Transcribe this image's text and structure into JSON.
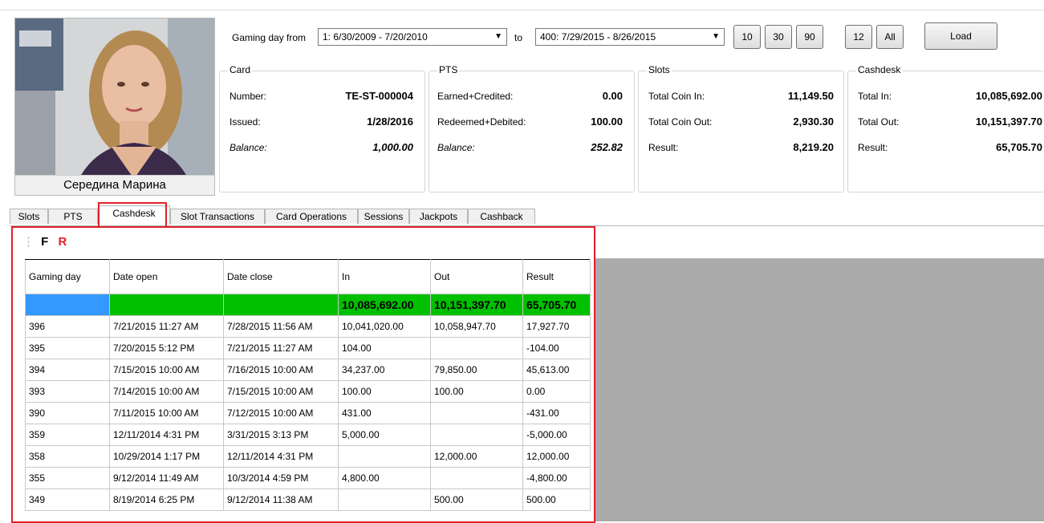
{
  "profile": {
    "name": "Середина Марина"
  },
  "filter": {
    "from_label": "Gaming day from",
    "from_value": "1: 6/30/2009 - 7/20/2010",
    "to_label": "to",
    "to_value": "400: 7/29/2015 - 8/26/2015",
    "quick_buttons": [
      "10",
      "30",
      "90",
      "12",
      "All"
    ],
    "load_label": "Load"
  },
  "groups": {
    "card": {
      "title": "Card",
      "number_label": "Number:",
      "number_value": "TE-ST-000004",
      "issued_label": "Issued:",
      "issued_value": "1/28/2016",
      "balance_label": "Balance:",
      "balance_value": "1,000.00"
    },
    "pts": {
      "title": "PTS",
      "earned_label": "Earned+Credited:",
      "earned_value": "0.00",
      "redeemed_label": "Redeemed+Debited:",
      "redeemed_value": "100.00",
      "balance_label": "Balance:",
      "balance_value": "252.82"
    },
    "slots": {
      "title": "Slots",
      "coin_in_label": "Total Coin In:",
      "coin_in_value": "11,149.50",
      "coin_out_label": "Total Coin Out:",
      "coin_out_value": "2,930.30",
      "result_label": "Result:",
      "result_value": "8,219.20"
    },
    "cashdesk": {
      "title": "Cashdesk",
      "in_label": "Total In:",
      "in_value": "10,085,692.00",
      "out_label": "Total Out:",
      "out_value": "10,151,397.70",
      "result_label": "Result:",
      "result_value": "65,705.70"
    }
  },
  "tabs": [
    "Slots",
    "PTS",
    "Cashdesk",
    "Slot Transactions",
    "Card Operations",
    "Sessions",
    "Jackpots",
    "Cashback"
  ],
  "active_tab": "Cashdesk",
  "toolbar": {
    "f_label": "F",
    "r_label": "R"
  },
  "grid": {
    "columns": [
      "Gaming day",
      "Date open",
      "Date close",
      "In",
      "Out",
      "Result"
    ],
    "totals": {
      "in": "10,085,692.00",
      "out": "10,151,397.70",
      "result": "65,705.70"
    },
    "rows": [
      [
        "396",
        "7/21/2015 11:27 AM",
        "7/28/2015 11:56 AM",
        "10,041,020.00",
        "10,058,947.70",
        "17,927.70"
      ],
      [
        "395",
        "7/20/2015 5:12 PM",
        "7/21/2015 11:27 AM",
        "104.00",
        "",
        "-104.00"
      ],
      [
        "394",
        "7/15/2015 10:00 AM",
        "7/16/2015 10:00 AM",
        "34,237.00",
        "79,850.00",
        "45,613.00"
      ],
      [
        "393",
        "7/14/2015 10:00 AM",
        "7/15/2015 10:00 AM",
        "100.00",
        "100.00",
        "0.00"
      ],
      [
        "390",
        "7/11/2015 10:00 AM",
        "7/12/2015 10:00 AM",
        "431.00",
        "",
        "-431.00"
      ],
      [
        "359",
        "12/11/2014 4:31 PM",
        "3/31/2015 3:13 PM",
        "5,000.00",
        "",
        "-5,000.00"
      ],
      [
        "358",
        "10/29/2014 1:17 PM",
        "12/11/2014 4:31 PM",
        "",
        "12,000.00",
        "12,000.00"
      ],
      [
        "355",
        "9/12/2014 11:49 AM",
        "10/3/2014 4:59 PM",
        "4,800.00",
        "",
        "-4,800.00"
      ],
      [
        "349",
        "8/19/2014 6:25 PM",
        "9/12/2014 11:38 AM",
        "",
        "500.00",
        "500.00"
      ]
    ]
  },
  "colors": {
    "highlight": "#e0202a",
    "totals_row": "#00c000",
    "selected_cell": "#3399ff",
    "r_button": "#e0202a"
  }
}
